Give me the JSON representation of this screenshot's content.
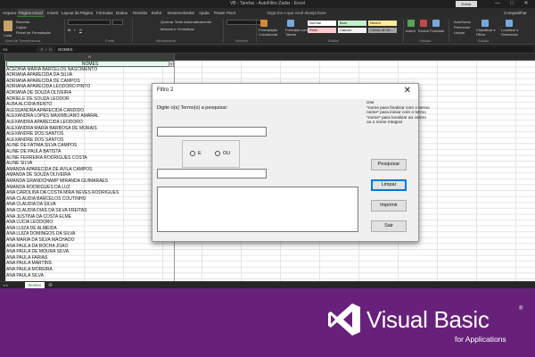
{
  "window": {
    "title": "VB - Tarefas - AutoFiltro Zadar - Excel",
    "signin_label": "Entrar",
    "controls": [
      "—",
      "□",
      "✕"
    ]
  },
  "ribbon": {
    "tabs": [
      "Arquivo",
      "Página Inicial",
      "Inserir",
      "Layout da Página",
      "Fórmulas",
      "Dados",
      "Revisão",
      "Exibir",
      "Desenvolvedor",
      "Ajuda",
      "Power Pivot"
    ],
    "active_tab_index": 1,
    "tell_me": "Diga-me o que você deseja fazer",
    "share": "Compartilhar",
    "clipboard": {
      "recortar": "Recortar",
      "copiar": "Copiar",
      "pincel": "Pincel de Formatação",
      "colar": "Colar",
      "group": "Área de Transferência"
    },
    "font_group": "Fonte",
    "alignment": {
      "wrap": "Quebrar Texto Automaticamente",
      "merge": "Mesclar e Centralizar",
      "group": "Alinhamento"
    },
    "number_group": "Número",
    "styles": {
      "cond_format": "Formatação Condicional",
      "format_table": "Formatar como Tabela",
      "items": [
        {
          "label": "Normal",
          "color": "#ffffff"
        },
        {
          "label": "Bom",
          "color": "#c6efce"
        },
        {
          "label": "Neutro",
          "color": "#ffeb9c"
        },
        {
          "label": "Ruim",
          "color": "#ffc7ce"
        },
        {
          "label": "Cálculo",
          "color": "#f2f2f2"
        },
        {
          "label": "Célula de Ve...",
          "color": "#a5a5a5"
        }
      ],
      "group": "Estilos"
    },
    "cells": {
      "inserir": "Inserir",
      "excluir": "Excluir",
      "formatar": "Formatar",
      "group": "Células"
    },
    "editing": {
      "autosoma": "AutoSoma",
      "preencher": "Preencher",
      "limpar": "Limpar",
      "classificar": "Classificar e Filtrar",
      "localizar": "Localizar e Selecionar",
      "group": "Edição"
    }
  },
  "formula_bar": {
    "name_box": "A1",
    "fx_icons": "✕ ✓ fx",
    "value": "NOMES"
  },
  "grid": {
    "column_header": "A",
    "header_cell": "NOMES",
    "filter_icon": "▾",
    "rows": [
      "ACEDINA MARIA BARCELOS NASCIMENTO",
      "ADRIANA APARECIDA DA SILVA",
      "ADRIANA APARECIDA DE CAMPOS",
      "ADRIANA APARECIDA LEODORO PINTO",
      "ADRIANA DE SOUZA OLIVEIRA",
      "ADRIELE DE SOUZA LEODOR",
      "ALBA ALCIDIA BENTO",
      "ALESSANDRA APARECIDA CANDIDO",
      "ALEXANDRA LOPES MAXIMILIANO AMARAL",
      "ALEXANDRA APARECIDA LEODORO",
      "ALEXANDRA MARIA BARBOSA DE MORAIS",
      "ALEXANDRE DOS SANTOS",
      "ALEXANDRE DOS SANTOS",
      "ALINE DE FATIMA SILVA CAMPOS",
      "ALINE DE PAULA BATISTA",
      "ALINE FERREIRA RODRIGUES COSTA",
      "ALINE SILVA",
      "AMANDA APARECIDA DE AVILA CAMPOS",
      "AMANDA DE SOUZA OLIVEIRA",
      "AMANDA GRANDCHAMP MIRANDA GUIMARAES",
      "AMANDA RODRIGUES DA LUZ",
      "ANA CAROLINA DA COSTA MIRA NEVES RODRIGUES",
      "ANA CLAUDIA BARCELOS COUTINHO",
      "ANA CLAUDIA DA SILVA",
      "ANA CLAUDIA DIAS DA SILVA FREITAS",
      "ANA JUSTINA DA COSTA ELME",
      "ANA LUCIA LEODORO",
      "ANA LUIZA DE ALMEIDA",
      "ANA LUIZA DOMINGOS DA SILVA",
      "ANA MARIA DA SILVA MACHADO",
      "ANA PAULA DA ROCHA JOAO",
      "ANA PAULA DE MOURA SILVA",
      "ANA PAULA FARIAS",
      "ANA PAULA MARTINS",
      "ANA PAULA MOREIRA",
      "ANA PAULA SILVA",
      "ANA ROSA DE OLIVEIRA"
    ]
  },
  "sheet_tabs": {
    "nav": "◂ ▸",
    "active": "Nomes",
    "add": "⊕"
  },
  "dialog": {
    "title": "Filtro 2",
    "close": "✕",
    "prompt": "Digite o(s) Termo(s) a pesquisar:",
    "term1_value": "",
    "term2_value": "",
    "radio_e": "E",
    "radio_ou": "OU",
    "hint": "Use\n*nome para finalizar com o termo\nnome* para iniciar com o termo\n*nome* para localizar ao centro\nou o nome integral",
    "buttons": {
      "pesquisar": "Pesquisar",
      "limpar": "Limpar",
      "imprimir": "Imprimir",
      "sair": "Sair"
    }
  },
  "banner": {
    "background": "#68217a",
    "title": "Visual Basic",
    "registered": "®",
    "subtitle": "for Applications",
    "logo_icon": "visual-studio-logo"
  }
}
